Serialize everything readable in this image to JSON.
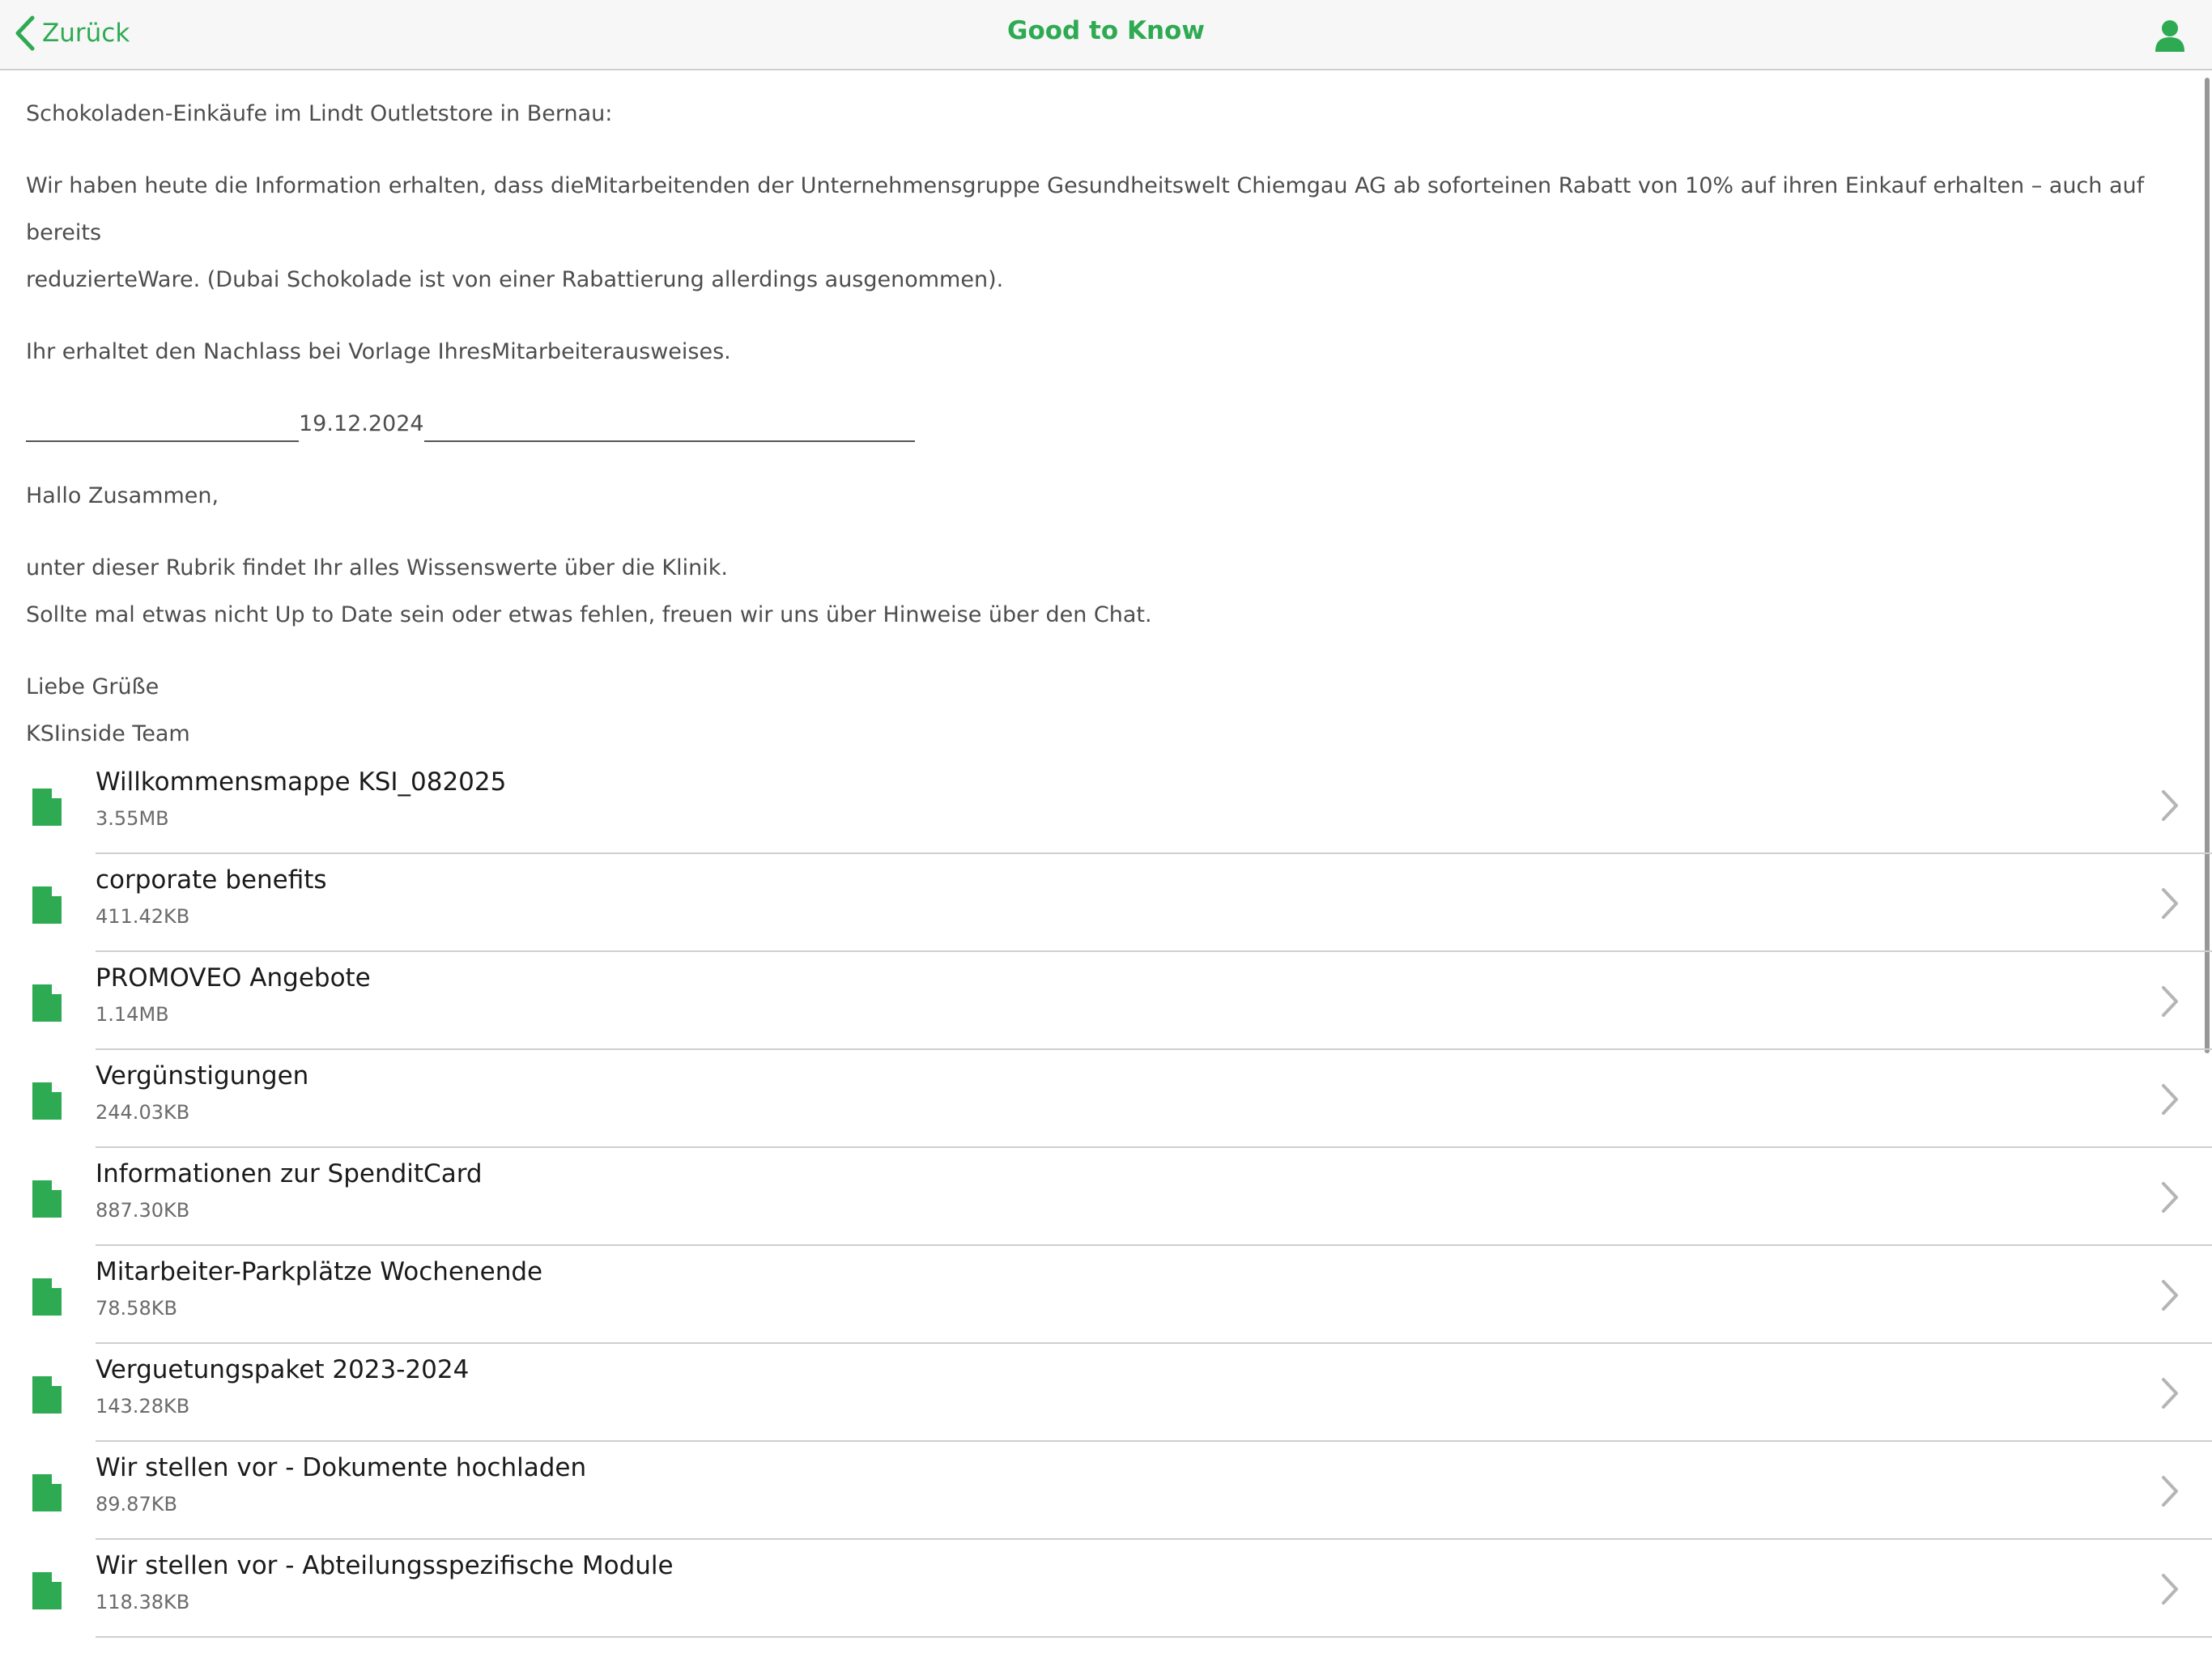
{
  "navbar": {
    "back_label": "Zurück",
    "title": "Good to Know",
    "back_icon": "chevron-left-icon",
    "profile_icon": "person-icon"
  },
  "colors": {
    "accent": "#2eaa52",
    "file_icon": "#2eaa52"
  },
  "content": {
    "p1": "Schokoladen-Einkäufe im Lindt Outletstore in Bernau:",
    "p2_line1": "Wir haben heute die Information erhalten, dass dieMitarbeitenden der Unternehmensgruppe Gesundheitswelt Chiemgau AG ab soforteinen Rabatt von 10% auf ihren Einkauf erhalten – auch auf bereits",
    "p2_line2": "reduzierteWare. (Dubai Schokolade ist von einer Rabattierung allerdings ausgenommen).",
    "p3": "Ihr erhaltet den Nachlass bei Vorlage IhresMitarbeiterausweises.",
    "date": "19.12.2024",
    "greeting": "Hallo Zusammen,",
    "p4_line1": "unter dieser Rubrik findet Ihr alles Wissenswerte über die Klinik.",
    "p4_line2": "Sollte mal etwas nicht Up to Date sein oder etwas fehlen, freuen wir uns über Hinweise über den Chat.",
    "closing": "Liebe Grüße",
    "signature": "KSIinside Team"
  },
  "files": [
    {
      "title": "Willkommensmappe KSI_082025",
      "size": "3.55MB"
    },
    {
      "title": "corporate benefits",
      "size": "411.42KB"
    },
    {
      "title": "PROMOVEO Angebote",
      "size": "1.14MB"
    },
    {
      "title": "Vergünstigungen",
      "size": "244.03KB"
    },
    {
      "title": "Informationen zur SpenditCard",
      "size": "887.30KB"
    },
    {
      "title": "Mitarbeiter-Parkplätze Wochenende",
      "size": "78.58KB"
    },
    {
      "title": "Verguetungspaket 2023-2024",
      "size": "143.28KB"
    },
    {
      "title": "Wir stellen vor - Dokumente hochladen",
      "size": "89.87KB"
    },
    {
      "title": "Wir stellen vor - Abteilungsspezifische Module",
      "size": "118.38KB"
    }
  ]
}
